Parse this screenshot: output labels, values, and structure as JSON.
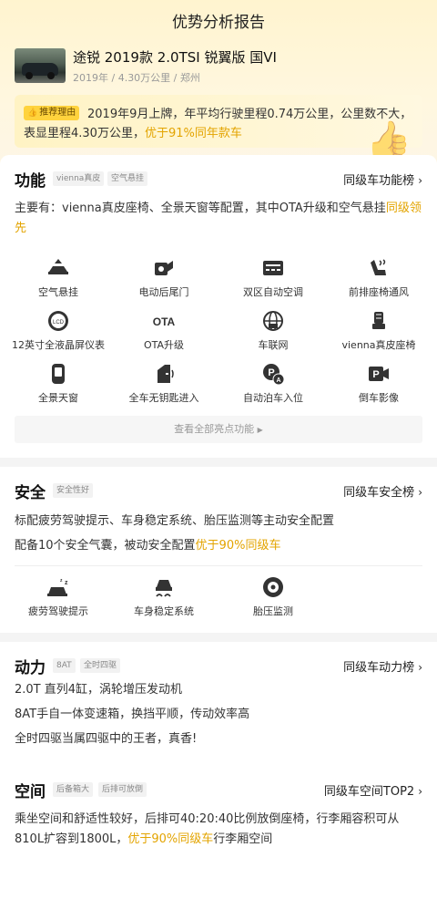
{
  "header": {
    "title": "优势分析报告"
  },
  "car": {
    "name": "途锐 2019款 2.0TSI 锐翼版 国VI",
    "meta": "2019年 / 4.30万公里 / 郑州"
  },
  "reason": {
    "tag": "推荐理由",
    "text_plain": "2019年9月上牌，年平均行驶里程0.74万公里，公里数不大，表显里程4.30万公里，",
    "text_highlight": "优于91%同年款车"
  },
  "features": {
    "title": "功能",
    "chips": [
      "vienna真皮",
      "空气悬挂"
    ],
    "rank": "同级车功能榜",
    "desc_plain": "主要有：vienna真皮座椅、全景天窗等配置，其中OTA升级和空气悬挂",
    "desc_highlight": "同级领先",
    "items": [
      {
        "label": "空气悬挂",
        "icon": "air-suspension-icon"
      },
      {
        "label": "电动后尾门",
        "icon": "power-tailgate-icon"
      },
      {
        "label": "双区自动空调",
        "icon": "climate-control-icon"
      },
      {
        "label": "前排座椅通风",
        "icon": "seat-ventilation-icon"
      },
      {
        "label": "12英寸全液晶屏仪表",
        "icon": "lcd-dashboard-icon"
      },
      {
        "label": "OTA升级",
        "icon": "ota-icon"
      },
      {
        "label": "车联网",
        "icon": "connected-car-icon"
      },
      {
        "label": "vienna真皮座椅",
        "icon": "leather-seat-icon"
      },
      {
        "label": "全景天窗",
        "icon": "panoramic-sunroof-icon"
      },
      {
        "label": "全车无钥匙进入",
        "icon": "keyless-entry-icon"
      },
      {
        "label": "自动泊车入位",
        "icon": "auto-parking-icon"
      },
      {
        "label": "倒车影像",
        "icon": "reverse-camera-icon"
      }
    ],
    "more": "查看全部亮点功能"
  },
  "safety": {
    "title": "安全",
    "chips": [
      "安全性好"
    ],
    "rank": "同级车安全榜",
    "line1": "标配疲劳驾驶提示、车身稳定系统、胎压监测等主动安全配置",
    "line2_plain": "配备10个安全气囊，被动安全配置",
    "line2_highlight": "优于90%同级车",
    "items": [
      {
        "label": "疲劳驾驶提示",
        "icon": "fatigue-alert-icon"
      },
      {
        "label": "车身稳定系统",
        "icon": "stability-control-icon"
      },
      {
        "label": "胎压监测",
        "icon": "tire-pressure-icon"
      }
    ]
  },
  "power": {
    "title": "动力",
    "chips": [
      "8AT",
      "全时四驱"
    ],
    "rank": "同级车动力榜",
    "lines": [
      "2.0T 直列4缸，涡轮增压发动机",
      "8AT手自一体变速箱，换挡平顺，传动效率高",
      "全时四驱当属四驱中的王者，真香!"
    ]
  },
  "space": {
    "title": "空间",
    "chips": [
      "后备箱大",
      "后排可放倒"
    ],
    "rank": "同级车空间TOP2",
    "desc_plain": "乘坐空间和舒适性较好，后排可40:20:40比例放倒座椅，行李厢容积可从810L扩容到1800L，",
    "desc_highlight": "优于90%同级车",
    "desc_tail": "行李厢空间"
  },
  "colors": {
    "highlight": "#e3a400",
    "tag_bg": "#ffd33d"
  }
}
